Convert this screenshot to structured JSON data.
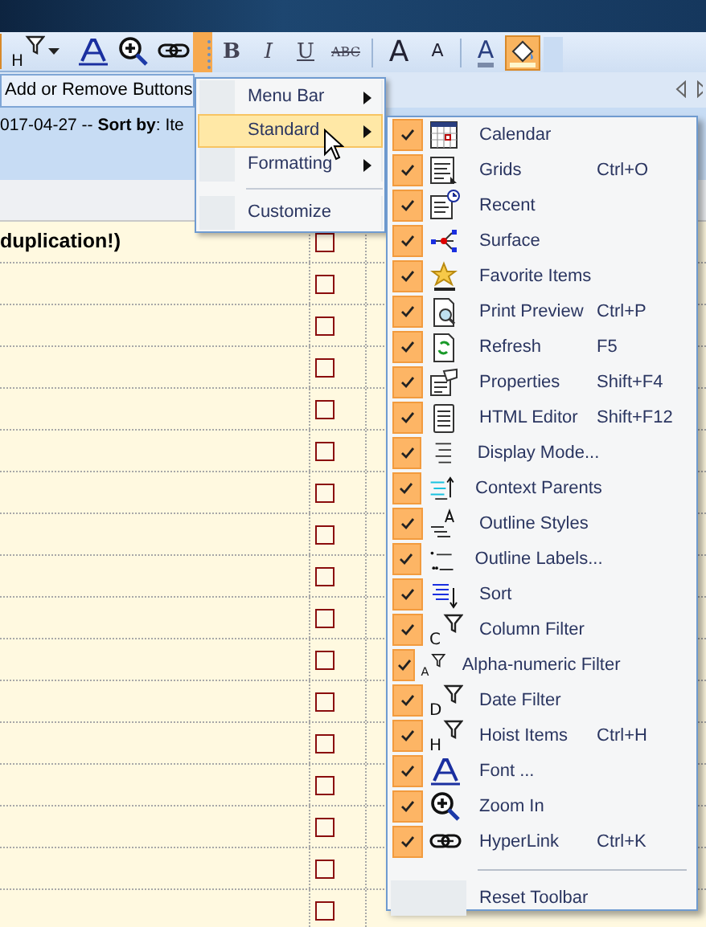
{
  "standard_toolbar": {
    "buttons": [
      {
        "kind": "filter",
        "glyph": "H",
        "has_dropdown": true
      },
      {
        "kind": "font"
      },
      {
        "kind": "zoom"
      },
      {
        "kind": "link"
      }
    ],
    "overflow_active": true
  },
  "formatting_toolbar": {
    "buttons": [
      {
        "kind": "text",
        "label": "B"
      },
      {
        "kind": "text",
        "label": "I"
      },
      {
        "kind": "text",
        "label": "U"
      },
      {
        "kind": "text",
        "label": "ABC"
      },
      {
        "kind": "grow",
        "label": "A"
      },
      {
        "kind": "shrink",
        "label": "A"
      },
      {
        "kind": "font_color",
        "label": "A",
        "selected": false
      },
      {
        "kind": "fill_color",
        "selected": true
      }
    ]
  },
  "add_remove_button": "Add or Remove Buttons",
  "info_line": "017-04-27 -- **Sort by**: Ite",
  "grid_rows": [
    {
      "text": "duplication!)",
      "checked": false
    },
    {
      "checked": false
    },
    {
      "checked": false
    },
    {
      "checked": false
    },
    {
      "checked": false
    },
    {
      "checked": false
    },
    {
      "checked": false
    },
    {
      "checked": false
    },
    {
      "checked": false
    },
    {
      "checked": false
    },
    {
      "checked": false
    },
    {
      "checked": false
    },
    {
      "checked": false
    },
    {
      "checked": false
    },
    {
      "checked": false
    },
    {
      "checked": false
    },
    {
      "checked": false
    }
  ],
  "toolbar_menu": {
    "items": [
      {
        "label": "Menu Bar",
        "has_submenu": true,
        "selected": false
      },
      {
        "label": "Standard",
        "has_submenu": true,
        "selected": true
      },
      {
        "label": "Formatting",
        "has_submenu": true,
        "selected": false
      },
      {
        "label": "Customize",
        "has_submenu": false,
        "selected": false
      }
    ]
  },
  "standard_menu": {
    "items": [
      {
        "label": "Calendar",
        "checked": true
      },
      {
        "label": "Grids",
        "shortcut": "Ctrl+O",
        "checked": true
      },
      {
        "label": "Recent",
        "checked": true
      },
      {
        "label": "Surface",
        "checked": true
      },
      {
        "label": "Favorite Items",
        "checked": true
      },
      {
        "label": "Print Preview",
        "shortcut": "Ctrl+P",
        "checked": true
      },
      {
        "label": "Refresh",
        "shortcut": "F5",
        "checked": true
      },
      {
        "label": "Properties",
        "shortcut": "Shift+F4",
        "checked": true
      },
      {
        "label": "HTML Editor",
        "shortcut": "Shift+F12",
        "checked": true
      },
      {
        "label": "Display Mode...",
        "checked": true
      },
      {
        "label": "Context Parents",
        "checked": true
      },
      {
        "label": "Outline Styles",
        "checked": true
      },
      {
        "label": "Outline Labels...",
        "checked": true
      },
      {
        "label": "Sort",
        "checked": true
      },
      {
        "label": "Column Filter",
        "glyph": "C",
        "checked": true
      },
      {
        "label": "Alpha-numeric Filter",
        "glyph": "A",
        "checked": true
      },
      {
        "label": "Date Filter",
        "glyph": "D",
        "checked": true
      },
      {
        "label": "Hoist Items",
        "glyph": "H",
        "shortcut": "Ctrl+H",
        "checked": true
      },
      {
        "label": "Font ...",
        "checked": true
      },
      {
        "label": "Zoom In",
        "checked": true
      },
      {
        "label": "HyperLink",
        "shortcut": "Ctrl+K",
        "checked": true
      }
    ],
    "reset_label": "Reset Toolbar"
  }
}
